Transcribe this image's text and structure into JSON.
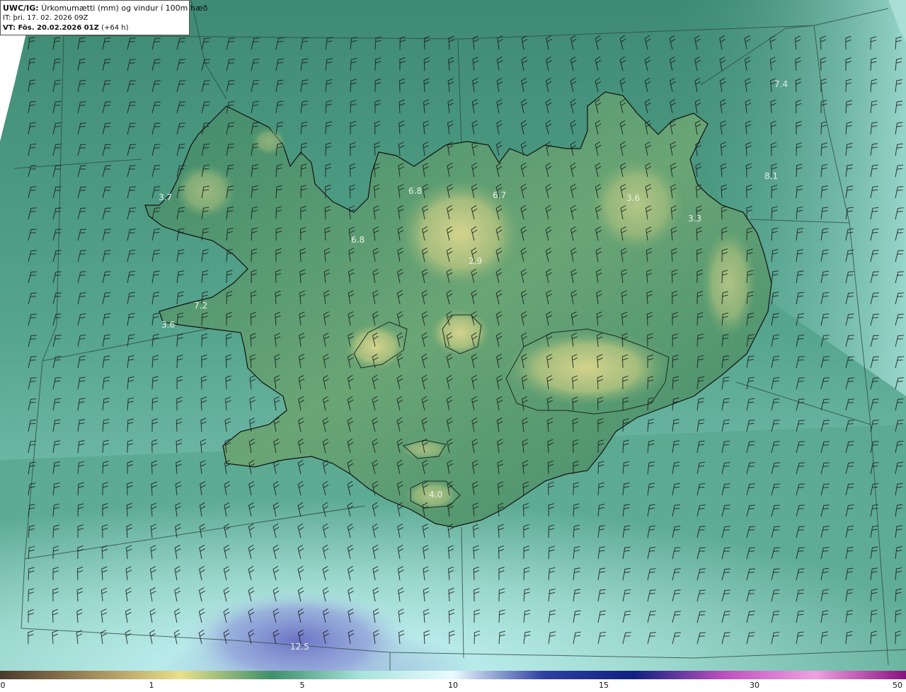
{
  "header": {
    "model_code": "UWC/IG:",
    "title": "Úrkomumætti (mm) og vindur í 100m hæð",
    "init_time": "IT: þri. 17. 02. 2026 09Z",
    "valid_label": "VT: Fös. 20.02.2026 01Z",
    "lead_time": "(+64 h)"
  },
  "map": {
    "labels": [
      {
        "text": "7.4"
      },
      {
        "text": "8.1"
      },
      {
        "text": "3.7"
      },
      {
        "text": "6.8"
      },
      {
        "text": "6.7"
      },
      {
        "text": "3.6"
      },
      {
        "text": "3.3"
      },
      {
        "text": "6.8"
      },
      {
        "text": "2.9"
      },
      {
        "text": "7.2"
      },
      {
        "text": "3.6"
      },
      {
        "text": "4.0"
      },
      {
        "text": "12.5"
      }
    ],
    "ocean_color": "#4f9e8a",
    "land_low_color": "#3f8e6e",
    "land_high_color": "#c9cf86",
    "south_sea_color": "#b6e6df",
    "deep_color": "#6d7dc8",
    "coast_color": "#111111"
  },
  "colorbar": {
    "ticks": [
      "0",
      "1",
      "5",
      "10",
      "15",
      "30",
      "50"
    ],
    "colors": [
      "#4a3a2c",
      "#a08a5a",
      "#e8e08a",
      "#3d8f6a",
      "#a8e4dc",
      "#e9fbff",
      "#3040a0",
      "#102080",
      "#c050c0",
      "#f0a0e0",
      "#8a1080"
    ]
  }
}
